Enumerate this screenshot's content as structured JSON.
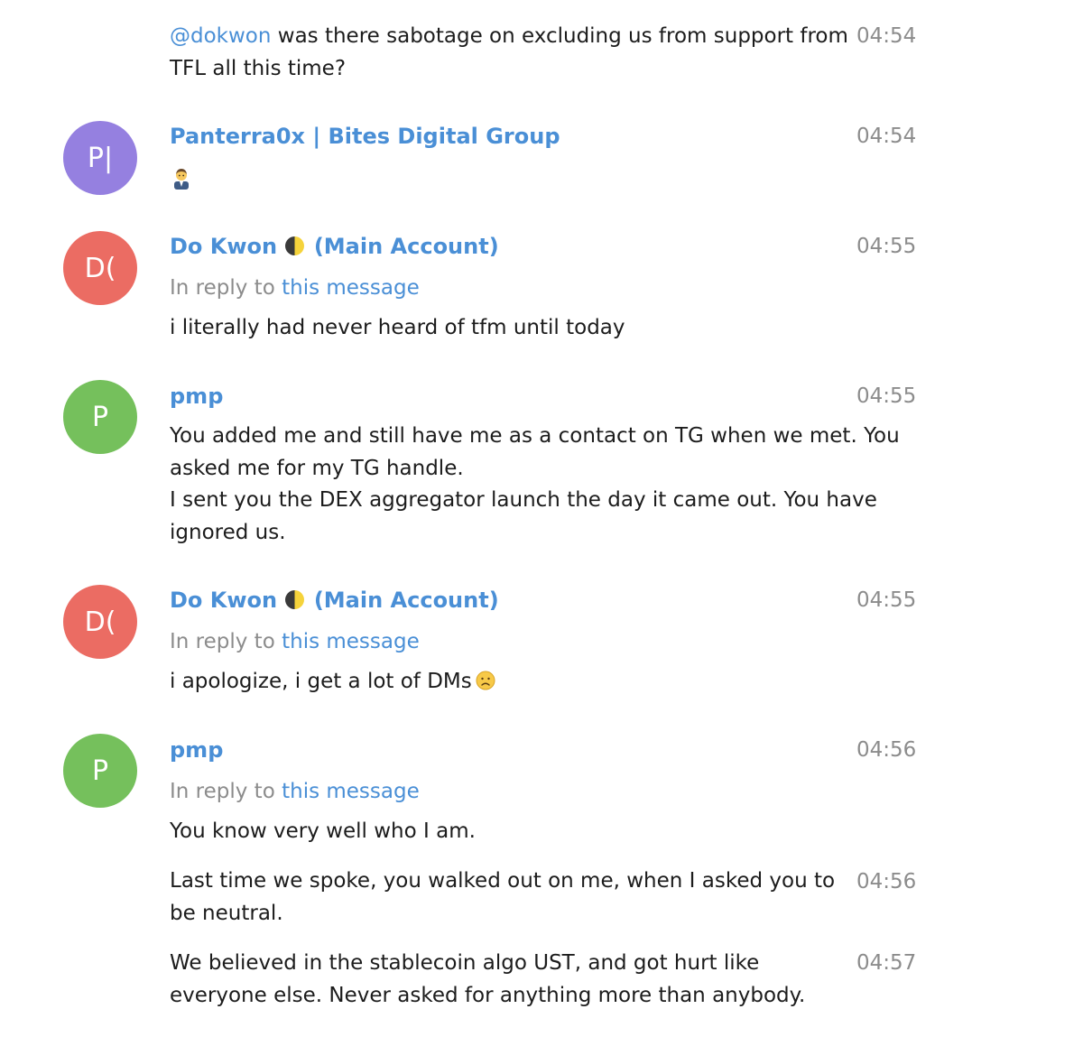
{
  "messages": [
    {
      "kind": "continuation",
      "mention": "@dokwon",
      "text": " was there sabotage on excluding us from support from TFL all this time?",
      "time": "04:54"
    },
    {
      "kind": "header",
      "avatar_initials": "P|",
      "avatar_color": "#9580e0",
      "name": "Panterra0x | Bites Digital Group",
      "time": "04:54",
      "emoji": "man-office-worker-emoji"
    },
    {
      "kind": "header",
      "avatar_initials": "D(",
      "avatar_color": "#eb6c63",
      "name": "Do Kwon",
      "name_suffix": "(Main Account)",
      "name_emoji": "moon-icon",
      "time": "04:55",
      "reply_prefix": "In reply to ",
      "reply_link": "this message",
      "text": "i literally had never heard of tfm until today"
    },
    {
      "kind": "header",
      "avatar_initials": "P",
      "avatar_color": "#75c05c",
      "name": "pmp",
      "time": "04:55",
      "text_lines": [
        "You added me and still have me as a contact on TG when we met. You asked me for my TG handle.",
        "I sent you the DEX aggregator launch the day it came out. You have ignored us."
      ]
    },
    {
      "kind": "header",
      "avatar_initials": "D(",
      "avatar_color": "#eb6c63",
      "name": "Do Kwon",
      "name_suffix": "(Main Account)",
      "name_emoji": "moon-icon",
      "time": "04:55",
      "reply_prefix": "In reply to ",
      "reply_link": "this message",
      "text": "i apologize, i get a lot of DMs",
      "text_emoji": "sad-face-icon"
    },
    {
      "kind": "header",
      "avatar_initials": "P",
      "avatar_color": "#75c05c",
      "name": "pmp",
      "time": "04:56",
      "reply_prefix": "In reply to ",
      "reply_link": "this message",
      "text": "You know very well who I am."
    },
    {
      "kind": "continuation",
      "text": "Last time we spoke, you walked out on me, when I asked you to be neutral.",
      "time": "04:56"
    },
    {
      "kind": "continuation",
      "text": "We believed in the stablecoin algo UST, and got hurt like everyone else. Never asked for anything more than anybody.",
      "time": "04:57"
    }
  ],
  "colors": {
    "link": "#4a8fd6",
    "meta": "#8c8c8c",
    "text": "#1c1c1c"
  }
}
